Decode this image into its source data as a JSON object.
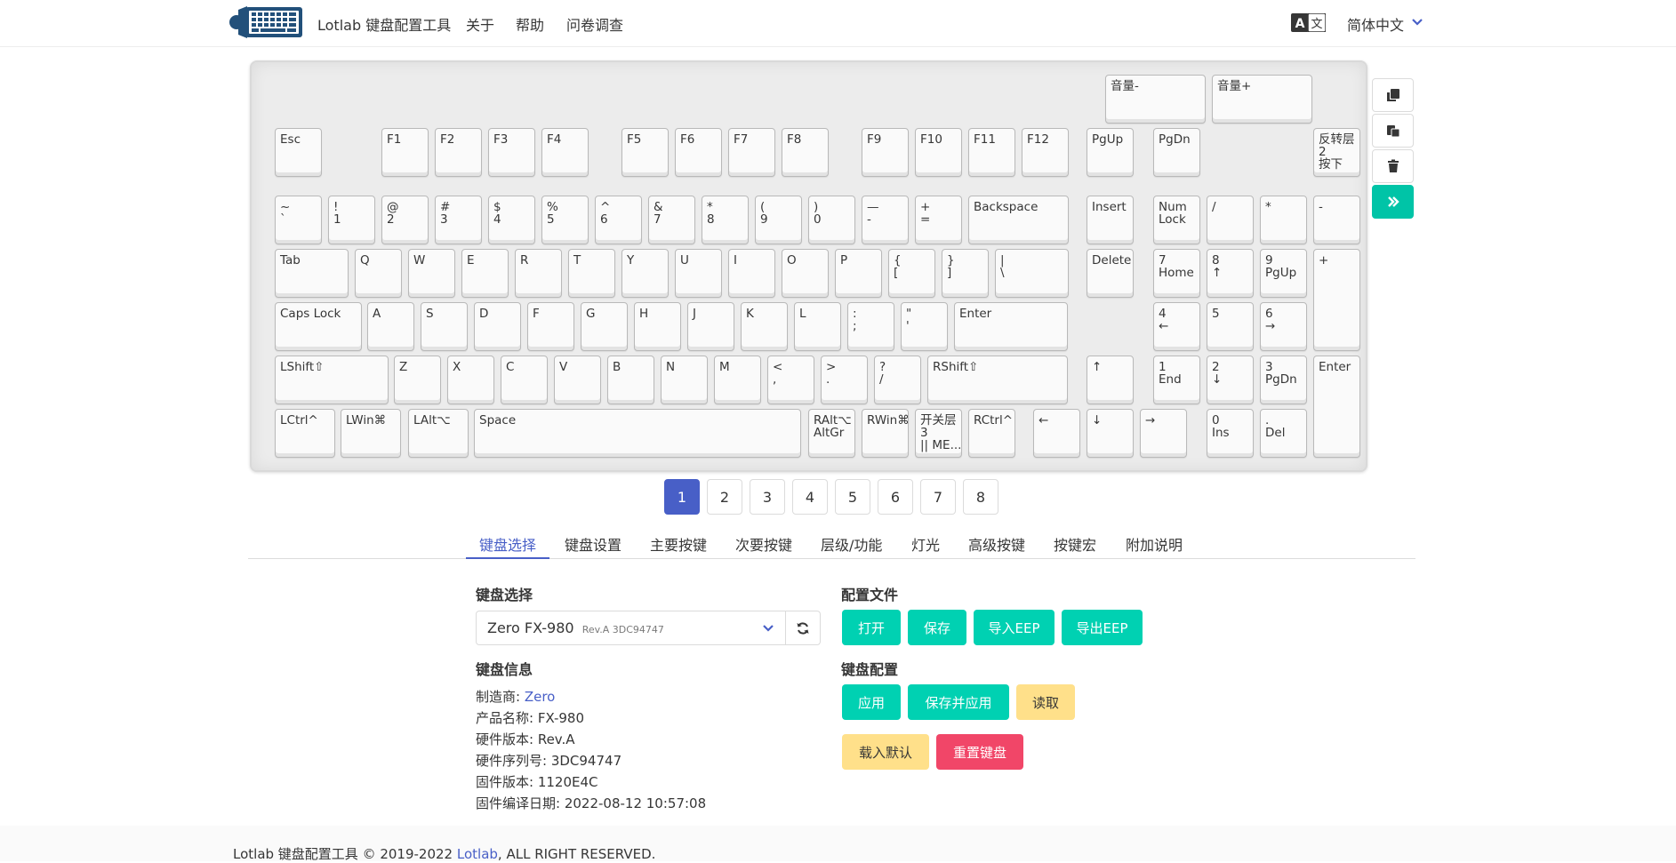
{
  "navbar": {
    "brand": "Lotlab 键盘配置工具",
    "about": "关于",
    "help": "帮助",
    "survey": "问卷调查",
    "language": "简体中文"
  },
  "keyboard": {
    "keys": [
      {
        "label": "音量-"
      },
      {
        "label": "音量+"
      },
      {
        "label": "Esc"
      },
      {
        "label": "F1"
      },
      {
        "label": "F2"
      },
      {
        "label": "F3"
      },
      {
        "label": "F4"
      },
      {
        "label": "F5"
      },
      {
        "label": "F6"
      },
      {
        "label": "F7"
      },
      {
        "label": "F8"
      },
      {
        "label": "F9"
      },
      {
        "label": "F10"
      },
      {
        "label": "F11"
      },
      {
        "label": "F12"
      },
      {
        "label": "PgUp"
      },
      {
        "label": "PgDn"
      },
      {
        "label": "反转层\n2\n按下"
      },
      {
        "label": "~\n`"
      },
      {
        "label": "!\n1"
      },
      {
        "label": "@\n2"
      },
      {
        "label": "#\n3"
      },
      {
        "label": "$\n4"
      },
      {
        "label": "%\n5"
      },
      {
        "label": "^\n6"
      },
      {
        "label": "&\n7"
      },
      {
        "label": "*\n8"
      },
      {
        "label": "(\n9"
      },
      {
        "label": ")\n0"
      },
      {
        "label": "—\n-"
      },
      {
        "label": "+\n="
      },
      {
        "label": "Backspace"
      },
      {
        "label": "Insert"
      },
      {
        "label": "Num\nLock"
      },
      {
        "label": "/"
      },
      {
        "label": "*"
      },
      {
        "label": "-"
      },
      {
        "label": "Tab"
      },
      {
        "label": "Q"
      },
      {
        "label": "W"
      },
      {
        "label": "E"
      },
      {
        "label": "R"
      },
      {
        "label": "T"
      },
      {
        "label": "Y"
      },
      {
        "label": "U"
      },
      {
        "label": "I"
      },
      {
        "label": "O"
      },
      {
        "label": "P"
      },
      {
        "label": "{\n["
      },
      {
        "label": "}\n]"
      },
      {
        "label": "|\n\\"
      },
      {
        "label": "Delete"
      },
      {
        "label": "7\nHome"
      },
      {
        "label": "8\n↑"
      },
      {
        "label": "9\nPgUp"
      },
      {
        "label": "+"
      },
      {
        "label": "Caps Lock"
      },
      {
        "label": "A"
      },
      {
        "label": "S"
      },
      {
        "label": "D"
      },
      {
        "label": "F"
      },
      {
        "label": "G"
      },
      {
        "label": "H"
      },
      {
        "label": "J"
      },
      {
        "label": "K"
      },
      {
        "label": "L"
      },
      {
        "label": ":\n;"
      },
      {
        "label": "\"\n'"
      },
      {
        "label": "Enter"
      },
      {
        "label": "4\n←"
      },
      {
        "label": "5"
      },
      {
        "label": "6\n→"
      },
      {
        "label": "LShift⇧"
      },
      {
        "label": "Z"
      },
      {
        "label": "X"
      },
      {
        "label": "C"
      },
      {
        "label": "V"
      },
      {
        "label": "B"
      },
      {
        "label": "N"
      },
      {
        "label": "M"
      },
      {
        "label": "<\n,"
      },
      {
        "label": ">\n."
      },
      {
        "label": "?\n/"
      },
      {
        "label": "RShift⇧"
      },
      {
        "label": "↑"
      },
      {
        "label": "1\nEnd"
      },
      {
        "label": "2\n↓"
      },
      {
        "label": "3\nPgDn"
      },
      {
        "label": "Enter"
      },
      {
        "label": "LCtrl^"
      },
      {
        "label": "LWin⌘"
      },
      {
        "label": "LAlt⌥"
      },
      {
        "label": "Space"
      },
      {
        "label": "RAlt⌥\nAltGr"
      },
      {
        "label": "RWin⌘"
      },
      {
        "label": "开关层\n3\n|| ME..."
      },
      {
        "label": "RCtrl^"
      },
      {
        "label": "←"
      },
      {
        "label": "↓"
      },
      {
        "label": "→"
      },
      {
        "label": "0\nIns"
      },
      {
        "label": ".\nDel"
      }
    ]
  },
  "toolbar": {
    "icons": [
      "copy-icon",
      "paste-icon",
      "trash-icon",
      "double-chevron-right-icon"
    ]
  },
  "layers": {
    "pages": [
      "1",
      "2",
      "3",
      "4",
      "5",
      "6",
      "7",
      "8"
    ],
    "current": "1"
  },
  "tabs": [
    {
      "label": "键盘选择"
    },
    {
      "label": "键盘设置"
    },
    {
      "label": "主要按键"
    },
    {
      "label": "次要按键"
    },
    {
      "label": "层级/功能"
    },
    {
      "label": "灯光"
    },
    {
      "label": "高级按键"
    },
    {
      "label": "按键宏"
    },
    {
      "label": "附加说明"
    }
  ],
  "keyboard_select": {
    "title": "键盘选择",
    "selected": "Zero FX-980",
    "selected_sub": "Rev.A 3DC94747"
  },
  "keyboard_info": {
    "title": "键盘信息",
    "manufacturer_label": "制造商: ",
    "manufacturer": "Zero",
    "product": "产品名称:  FX-980",
    "hardware": "硬件版本:  Rev.A",
    "serial": "硬件序列号:  3DC94747",
    "firmware": "固件版本:  1120E4C",
    "build_date": "固件编译日期:  2022-08-12 10:57:08"
  },
  "config_file": {
    "title": "配置文件",
    "open": "打开",
    "save": "保存",
    "import_eep": "导入EEP",
    "export_eep": "导出EEP"
  },
  "keyboard_config": {
    "title": "键盘配置",
    "apply": "应用",
    "save_apply": "保存并应用",
    "read": "读取",
    "load_default": "载入默认",
    "reset": "重置键盘"
  },
  "footer": {
    "prefix": "Lotlab 键盘配置工具 © 2019-2022 ",
    "link": "Lotlab",
    "suffix": ", ALL RIGHT RESERVED."
  },
  "colors": {
    "primary": "#485fc7",
    "teal": "#00d1b2",
    "warning": "#ffe08a",
    "danger": "#f14668"
  }
}
